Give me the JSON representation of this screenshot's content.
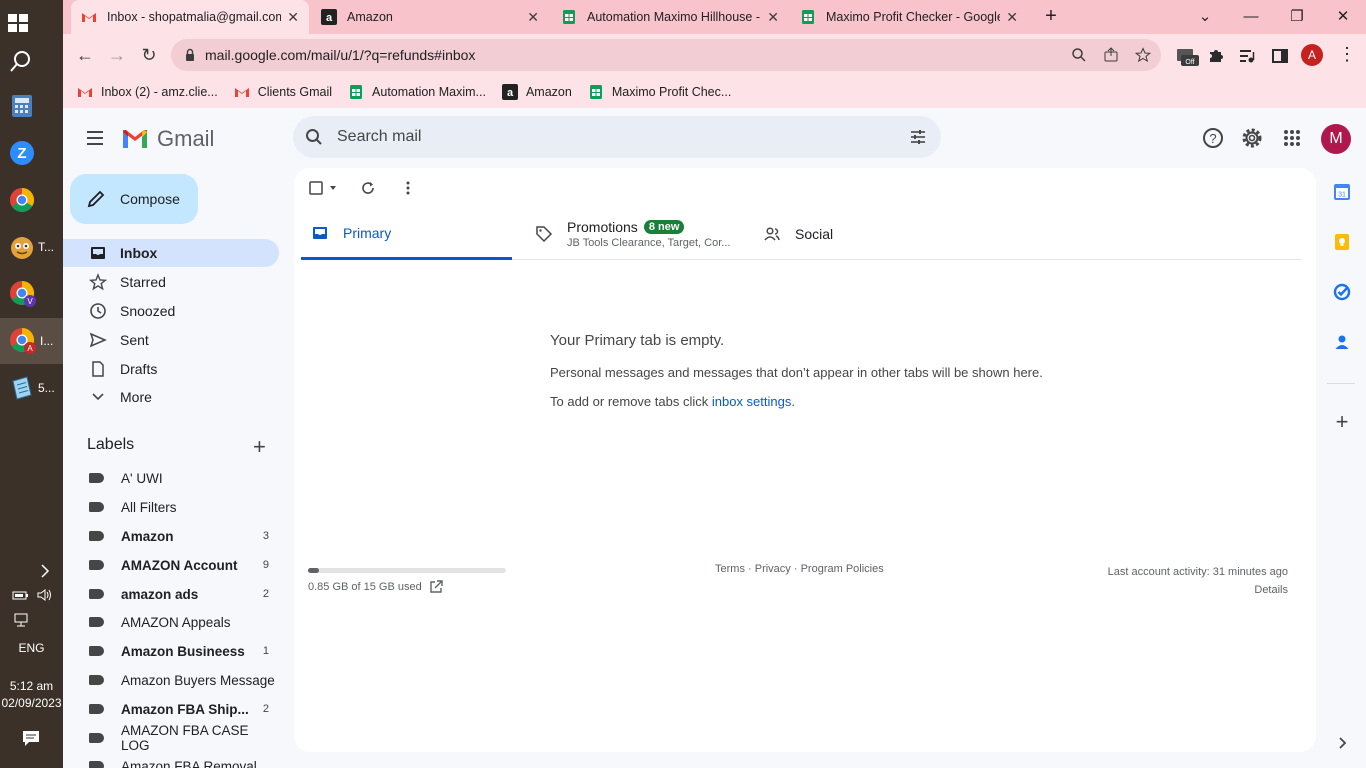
{
  "taskbar": {
    "items": [
      {
        "label": ""
      },
      {
        "label": ""
      },
      {
        "label": ""
      },
      {
        "label": "T..."
      },
      {
        "label": ""
      },
      {
        "label": "I..."
      },
      {
        "label": "5..."
      }
    ],
    "lang": "ENG",
    "time": "5:12 am",
    "date": "02/09/2023"
  },
  "browser": {
    "tabs": [
      {
        "title": "Inbox - shopatmalia@gmail.com"
      },
      {
        "title": "Amazon"
      },
      {
        "title": "Automation Maximo Hillhouse - "
      },
      {
        "title": "Maximo Profit Checker - Google"
      }
    ],
    "url": "mail.google.com/mail/u/1/?q=refunds#inbox",
    "profile_initial": "A",
    "bookmarks": [
      {
        "label": "Inbox (2) - amz.clie..."
      },
      {
        "label": "Clients Gmail"
      },
      {
        "label": "Automation Maxim..."
      },
      {
        "label": "Amazon"
      },
      {
        "label": "Maximo Profit Chec..."
      }
    ],
    "ext_badge": "Off"
  },
  "gmail": {
    "logo_text": "Gmail",
    "search_placeholder": "Search mail",
    "avatar_initial": "M",
    "compose_label": "Compose",
    "nav": [
      {
        "label": "Inbox"
      },
      {
        "label": "Starred"
      },
      {
        "label": "Snoozed"
      },
      {
        "label": "Sent"
      },
      {
        "label": "Drafts"
      },
      {
        "label": "More"
      }
    ],
    "labels_title": "Labels",
    "labels": [
      {
        "name": "A' UWI",
        "count": ""
      },
      {
        "name": "All Filters",
        "count": ""
      },
      {
        "name": "Amazon",
        "count": "3"
      },
      {
        "name": "AMAZON Account",
        "count": "9"
      },
      {
        "name": "amazon ads",
        "count": "2"
      },
      {
        "name": "AMAZON Appeals",
        "count": ""
      },
      {
        "name": "Amazon Busineess",
        "count": "1"
      },
      {
        "name": "Amazon Buyers Message",
        "count": ""
      },
      {
        "name": "Amazon FBA Ship...",
        "count": "2"
      },
      {
        "name": "AMAZON FBA CASE LOG",
        "count": ""
      },
      {
        "name": "Amazon FBA Removal",
        "count": ""
      }
    ],
    "tabs": {
      "primary": "Primary",
      "promotions": "Promotions",
      "promotions_badge": "8 new",
      "promotions_sub": "JB Tools Clearance, Target, Cor...",
      "social": "Social"
    },
    "empty": {
      "title": "Your Primary tab is empty.",
      "line1": "Personal messages and messages that don’t appear in other tabs will be shown here.",
      "line2_prefix": "To add or remove tabs click ",
      "line2_link": "inbox settings",
      "line2_suffix": "."
    },
    "footer": {
      "storage": "0.85 GB of 15 GB used",
      "storage_fraction": 0.057,
      "terms": "Terms",
      "privacy": "Privacy",
      "policies": "Program Policies",
      "sep": " · ",
      "activity": "Last account activity: 31 minutes ago",
      "details": "Details"
    }
  },
  "colors": {
    "chrome_frame": "#f9c3cb",
    "chrome_toolbar": "#fde3e7",
    "gmail_bg": "#f6f8fc",
    "compose": "#c2e7ff",
    "active_nav": "#d3e3fd",
    "accent": "#0b57d0",
    "badge_green": "#188038",
    "avatar": "#b0174d"
  }
}
